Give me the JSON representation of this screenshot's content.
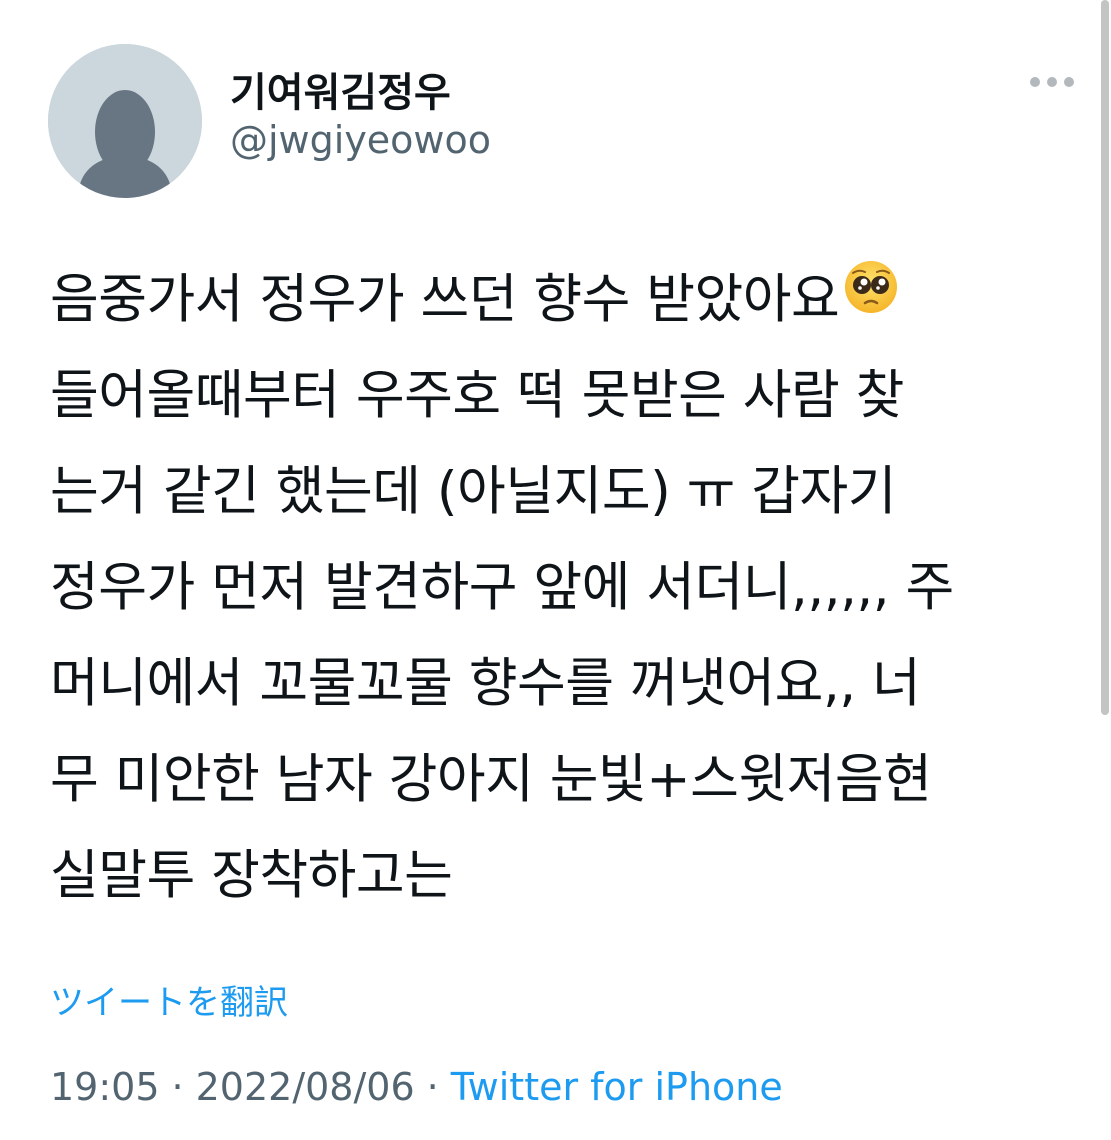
{
  "author": {
    "display_name": "기여워김정우",
    "handle": "@jwgiyeowoo"
  },
  "tweet": {
    "lines": [
      "음중가서 정우가 쓰던 향수 받았아요",
      "들어올때부터 우주호 떡 못받은 사람 찾",
      "는거 같긴 했는데 (아닐지도) ㅠ 갑자기",
      "정우가 먼저 발견하구 앞에 서더니,,,,,, 주",
      "머니에서 꼬물꼬물 향수를 꺼냇어요,, 너",
      "무 미안한 남자 강아지 눈빛+스윗저음현",
      "실말투 장착하고는"
    ],
    "emoji": "pleading-face"
  },
  "translate_label": "ツイートを翻訳",
  "meta": {
    "time": "19:05",
    "date": "2022/08/06",
    "separator": "·",
    "source": "Twitter for iPhone"
  },
  "icons": {
    "more": "more-horizontal-icon",
    "avatar": "default-avatar-icon"
  },
  "colors": {
    "link": "#1d9bf0",
    "secondary_text": "#536471",
    "primary_text": "#0f1419",
    "avatar_bg": "#ccd6dd",
    "avatar_fg": "#687684"
  }
}
